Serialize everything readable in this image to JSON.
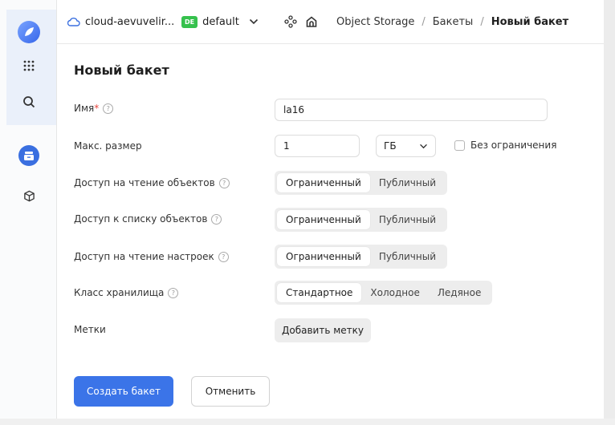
{
  "header": {
    "cloud_name": "cloud-aevuvelir...",
    "folder_badge": "DE",
    "folder_name": "default",
    "breadcrumb": [
      "Object Storage",
      "Бакеты",
      "Новый бакет"
    ],
    "separator": "/"
  },
  "page": {
    "title": "Новый бакет"
  },
  "form": {
    "name": {
      "label": "Имя",
      "required_mark": "*",
      "value": "la16"
    },
    "max_size": {
      "label": "Макс. размер",
      "value": "1",
      "unit": "ГБ",
      "unlimited_label": "Без ограничения",
      "unlimited_checked": false
    },
    "read_objects": {
      "label": "Доступ на чтение объектов",
      "options": [
        "Ограниченный",
        "Публичный"
      ],
      "selected": "Ограниченный"
    },
    "list_objects": {
      "label": "Доступ к списку объектов",
      "options": [
        "Ограниченный",
        "Публичный"
      ],
      "selected": "Ограниченный"
    },
    "read_settings": {
      "label": "Доступ на чтение настроек",
      "options": [
        "Ограниченный",
        "Публичный"
      ],
      "selected": "Ограниченный"
    },
    "storage_class": {
      "label": "Класс хранилища",
      "options": [
        "Стандартное",
        "Холодное",
        "Ледяное"
      ],
      "selected": "Стандартное"
    },
    "tags": {
      "label": "Метки",
      "add_label": "Добавить метку"
    }
  },
  "actions": {
    "create_label": "Создать бакет",
    "cancel_label": "Отменить"
  },
  "colors": {
    "primary": "#3b74e8",
    "folder_badge": "#36c14d",
    "required": "#e8453c"
  },
  "icons": [
    "cloud-icon",
    "chevron-down-icon",
    "apps-grid-icon",
    "search-icon",
    "home-icon",
    "services-icon",
    "storage-icon",
    "cube-icon",
    "help-icon"
  ]
}
